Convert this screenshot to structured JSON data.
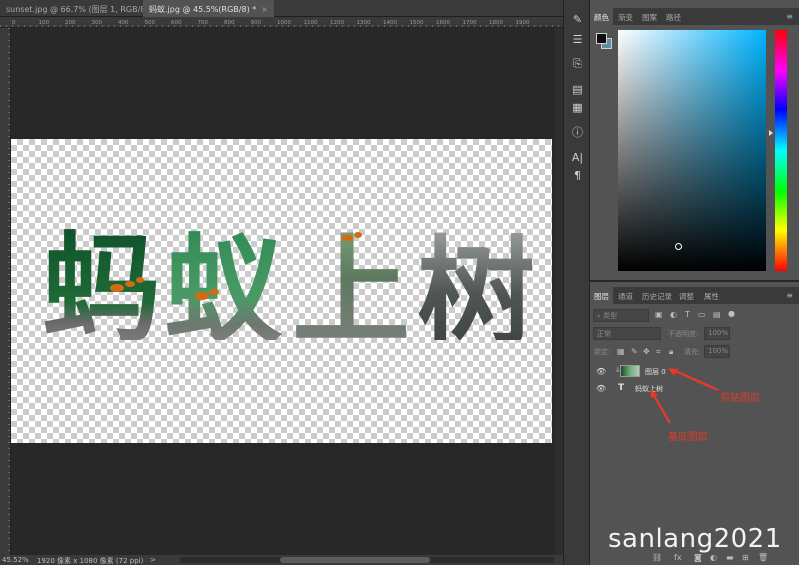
{
  "tabs": [
    {
      "label": "sunset.jpg @ 66.7% (图层 1, RGB/8) *",
      "close": "×"
    },
    {
      "label": "蚂蚁.jpg @ 45.5%(RGB/8) *",
      "close": "×"
    }
  ],
  "ruler_top_labels": [
    "0",
    "100",
    "200",
    "300",
    "400",
    "500",
    "600",
    "700",
    "800",
    "900",
    "1000",
    "1100",
    "1200",
    "1300",
    "1400",
    "1500",
    "1600",
    "1700",
    "1800",
    "1900"
  ],
  "artwork_text": "蚂蚁上树",
  "status": {
    "zoom": "45.52%",
    "doc_info": "1920 像素 x 1080 像素 (72 ppi)",
    "arrow": ">"
  },
  "tools": [
    "brush-icon",
    "adjust-icon",
    "clone-icon",
    "panel-icon",
    "history-icon",
    "info-icon",
    "character-icon",
    "paragraph-icon"
  ],
  "color_panel": {
    "tabs": [
      "颜色",
      "渐变",
      "图案",
      "路径"
    ],
    "active_tab": 0,
    "foreground": "#0d0d0d",
    "background": "#5f8ea3",
    "hue_color": "#00b4ff"
  },
  "layers_panel": {
    "tabs": [
      "图层",
      "通道",
      "历史记录",
      "调整",
      "属性"
    ],
    "active_tab": 0,
    "filter_label": "类型",
    "blend_mode": "正常",
    "opacity_label": "不透明度:",
    "opacity_value": "100%",
    "lock_label": "锁定:",
    "fill_label": "填充:",
    "fill_value": "100%",
    "layers": [
      {
        "name": "图层 0",
        "type": "image",
        "clipped": true
      },
      {
        "name": "蚂蚁上树",
        "type": "text",
        "clipped": false
      }
    ],
    "bottom_icons": [
      "link-icon",
      "fx-icon",
      "mask-icon",
      "adjustment-icon",
      "folder-icon",
      "new-layer-icon",
      "trash-icon"
    ]
  },
  "annotations": {
    "clip_layer": "剪贴图层",
    "base_layer": "基底图层"
  },
  "watermark": "sanlang2021"
}
